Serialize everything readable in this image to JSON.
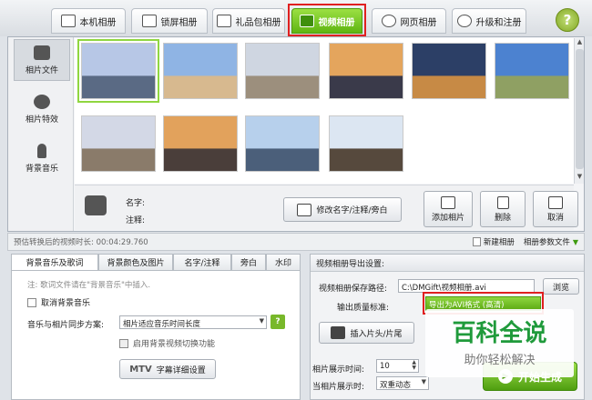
{
  "tabs": [
    {
      "label": "本机相册",
      "icon": "camera-icon"
    },
    {
      "label": "锁屏相册",
      "icon": "monitor-icon"
    },
    {
      "label": "礼品包相册",
      "icon": "gift-icon"
    },
    {
      "label": "视频相册",
      "icon": "film-icon"
    },
    {
      "label": "网页相册",
      "icon": "ie-icon"
    },
    {
      "label": "升级和注册",
      "icon": "globe-icon"
    }
  ],
  "help_label": "?",
  "sidebar": {
    "items": [
      {
        "label": "相片文件",
        "icon": "camera-icon"
      },
      {
        "label": "相片特效",
        "icon": "effects-icon"
      },
      {
        "label": "背景音乐",
        "icon": "music-note-icon"
      }
    ]
  },
  "photos": [
    {
      "sky": "#b7c7e6",
      "ground": "#5a6a84"
    },
    {
      "sky": "#8fb4e4",
      "ground": "#d7b98f"
    },
    {
      "sky": "#cfd6e1",
      "ground": "#9c8f7d"
    },
    {
      "sky": "#e4a55d",
      "ground": "#3a3a4a"
    },
    {
      "sky": "#2c3f66",
      "ground": "#c78a45"
    },
    {
      "sky": "#4c82d0",
      "ground": "#8fa063"
    },
    {
      "sky": "#d3d8e6",
      "ground": "#8a7b6a"
    },
    {
      "sky": "#e2a25c",
      "ground": "#4a3e3a"
    },
    {
      "sky": "#b7d0ec",
      "ground": "#4b5f7a"
    },
    {
      "sky": "#dce6f2",
      "ground": "#56493d"
    }
  ],
  "info": {
    "name_label": "名字:",
    "note_label": "注释:",
    "edit_button": "修改名字/注释/旁白",
    "add_photo": "添加相片",
    "delete": "删除",
    "cancel": "取消"
  },
  "status": {
    "duration": "预估转换后的视频时长: 00:04:29.760",
    "new_album": "新建相册",
    "album_params": "相册参数文件"
  },
  "left_tabs": [
    "背景音乐及歌词",
    "背景颜色及图片",
    "名字/注释",
    "旁白",
    "水印"
  ],
  "music": {
    "note": "注: 歌词文件请在\"背景音乐\"中插入.",
    "cancel_music": "取消背景音乐",
    "sync_label": "音乐与相片同步方案:",
    "sync_value": "相片适应音乐时间长度",
    "enable_switch": "启用背景视频切换功能",
    "mtv_label": "MTV",
    "lyrics_button": "字幕详细设置"
  },
  "export": {
    "title": "视频相册导出设置:",
    "path_label": "视频相册保存路径:",
    "path_value": "C:\\DMGift\\视频相册.avi",
    "browse": "浏览",
    "quality_label": "输出质量标准:",
    "quality_value": "导出为AVI格式 (高清)",
    "insert_button": "插入片头/片尾",
    "show_time_label": "相片展示时间:",
    "show_time_value": "10",
    "show_mode_label": "当相片展示时:",
    "show_mode_value": "双重动态",
    "start_button": "开始生成"
  },
  "watermark": {
    "main": "百科全说",
    "sub": "助你轻松解决"
  }
}
